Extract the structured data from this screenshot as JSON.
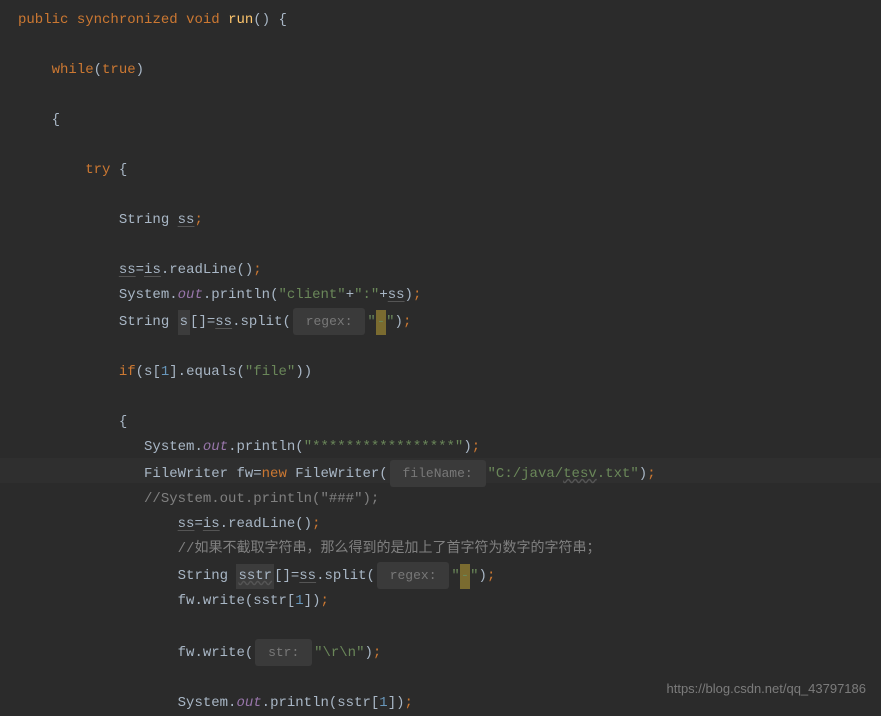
{
  "line1": {
    "public": "public",
    "synchronized": "synchronized",
    "void": "void",
    "run": "run",
    "parens": "()",
    "brace": " {"
  },
  "line3": {
    "while": "while",
    "true": "true"
  },
  "line5": {
    "brace": "{"
  },
  "line7": {
    "try": "try",
    "brace": " {"
  },
  "line9": {
    "type": "String ",
    "var": "ss",
    "semi": ";"
  },
  "line11": {
    "var": "ss",
    "eq": "=",
    "is": "is",
    "dot": ".readLine()",
    "semi": ";"
  },
  "line12": {
    "pre": "System.",
    "out": "out",
    "print": ".println(",
    "str1": "\"client\"",
    "plus1": "+",
    "str2": "\":\"",
    "plus2": "+",
    "ss": "ss",
    "close": ")",
    "semi": ";"
  },
  "line13": {
    "type": "String ",
    "s": "s",
    "arr": "[]=",
    "ss": "ss",
    "split": ".split(",
    "hint": " regex: ",
    "str": "\"",
    "op": "-",
    "strend": "\"",
    "close": ")",
    "semi": ";"
  },
  "line15": {
    "if": "if",
    "open": "(s[",
    "num": "1",
    "mid": "].equals(",
    "str": "\"file\"",
    "close": "))"
  },
  "line17": {
    "brace": "{"
  },
  "line18": {
    "pre": "System.",
    "out": "out",
    "print": ".println(",
    "str": "\"*****************\"",
    "close": ")",
    "semi": ";"
  },
  "line19": {
    "type": "FileWriter fw=",
    "new": "new",
    "cls": " FileWriter(",
    "hint": " fileName: ",
    "str1": "\"C:/java/",
    "wavy": "tesv",
    "str2": ".txt\"",
    "close": ")",
    "semi": ";"
  },
  "line20": {
    "comment": "//System.out.println(\"###\");"
  },
  "line21": {
    "ss": "ss",
    "eq": "=",
    "is": "is",
    "rest": ".readLine()",
    "semi": ";"
  },
  "line22": {
    "comment": "//如果不截取字符串，那么得到的是加上了首字符为数字的字符串；"
  },
  "line23": {
    "type": "String ",
    "sstr": "sstr",
    "arr": "[]=",
    "ss": "ss",
    "split": ".split(",
    "hint": " regex: ",
    "str1": "\"",
    "op": "-",
    "str2": "\"",
    "close": ")",
    "semi": ";"
  },
  "line24": {
    "pre": "fw.write(sstr[",
    "num": "1",
    "close": "])",
    "semi": ";"
  },
  "line26": {
    "pre": "fw.write(",
    "hint": " str: ",
    "str": "\"\\r\\n\"",
    "close": ")",
    "semi": ";"
  },
  "line28": {
    "pre": "System.",
    "out": "out",
    "print": ".println(sstr[",
    "num": "1",
    "close": "])",
    "semi": ";"
  },
  "watermark": "https://blog.csdn.net/qq_43797186"
}
